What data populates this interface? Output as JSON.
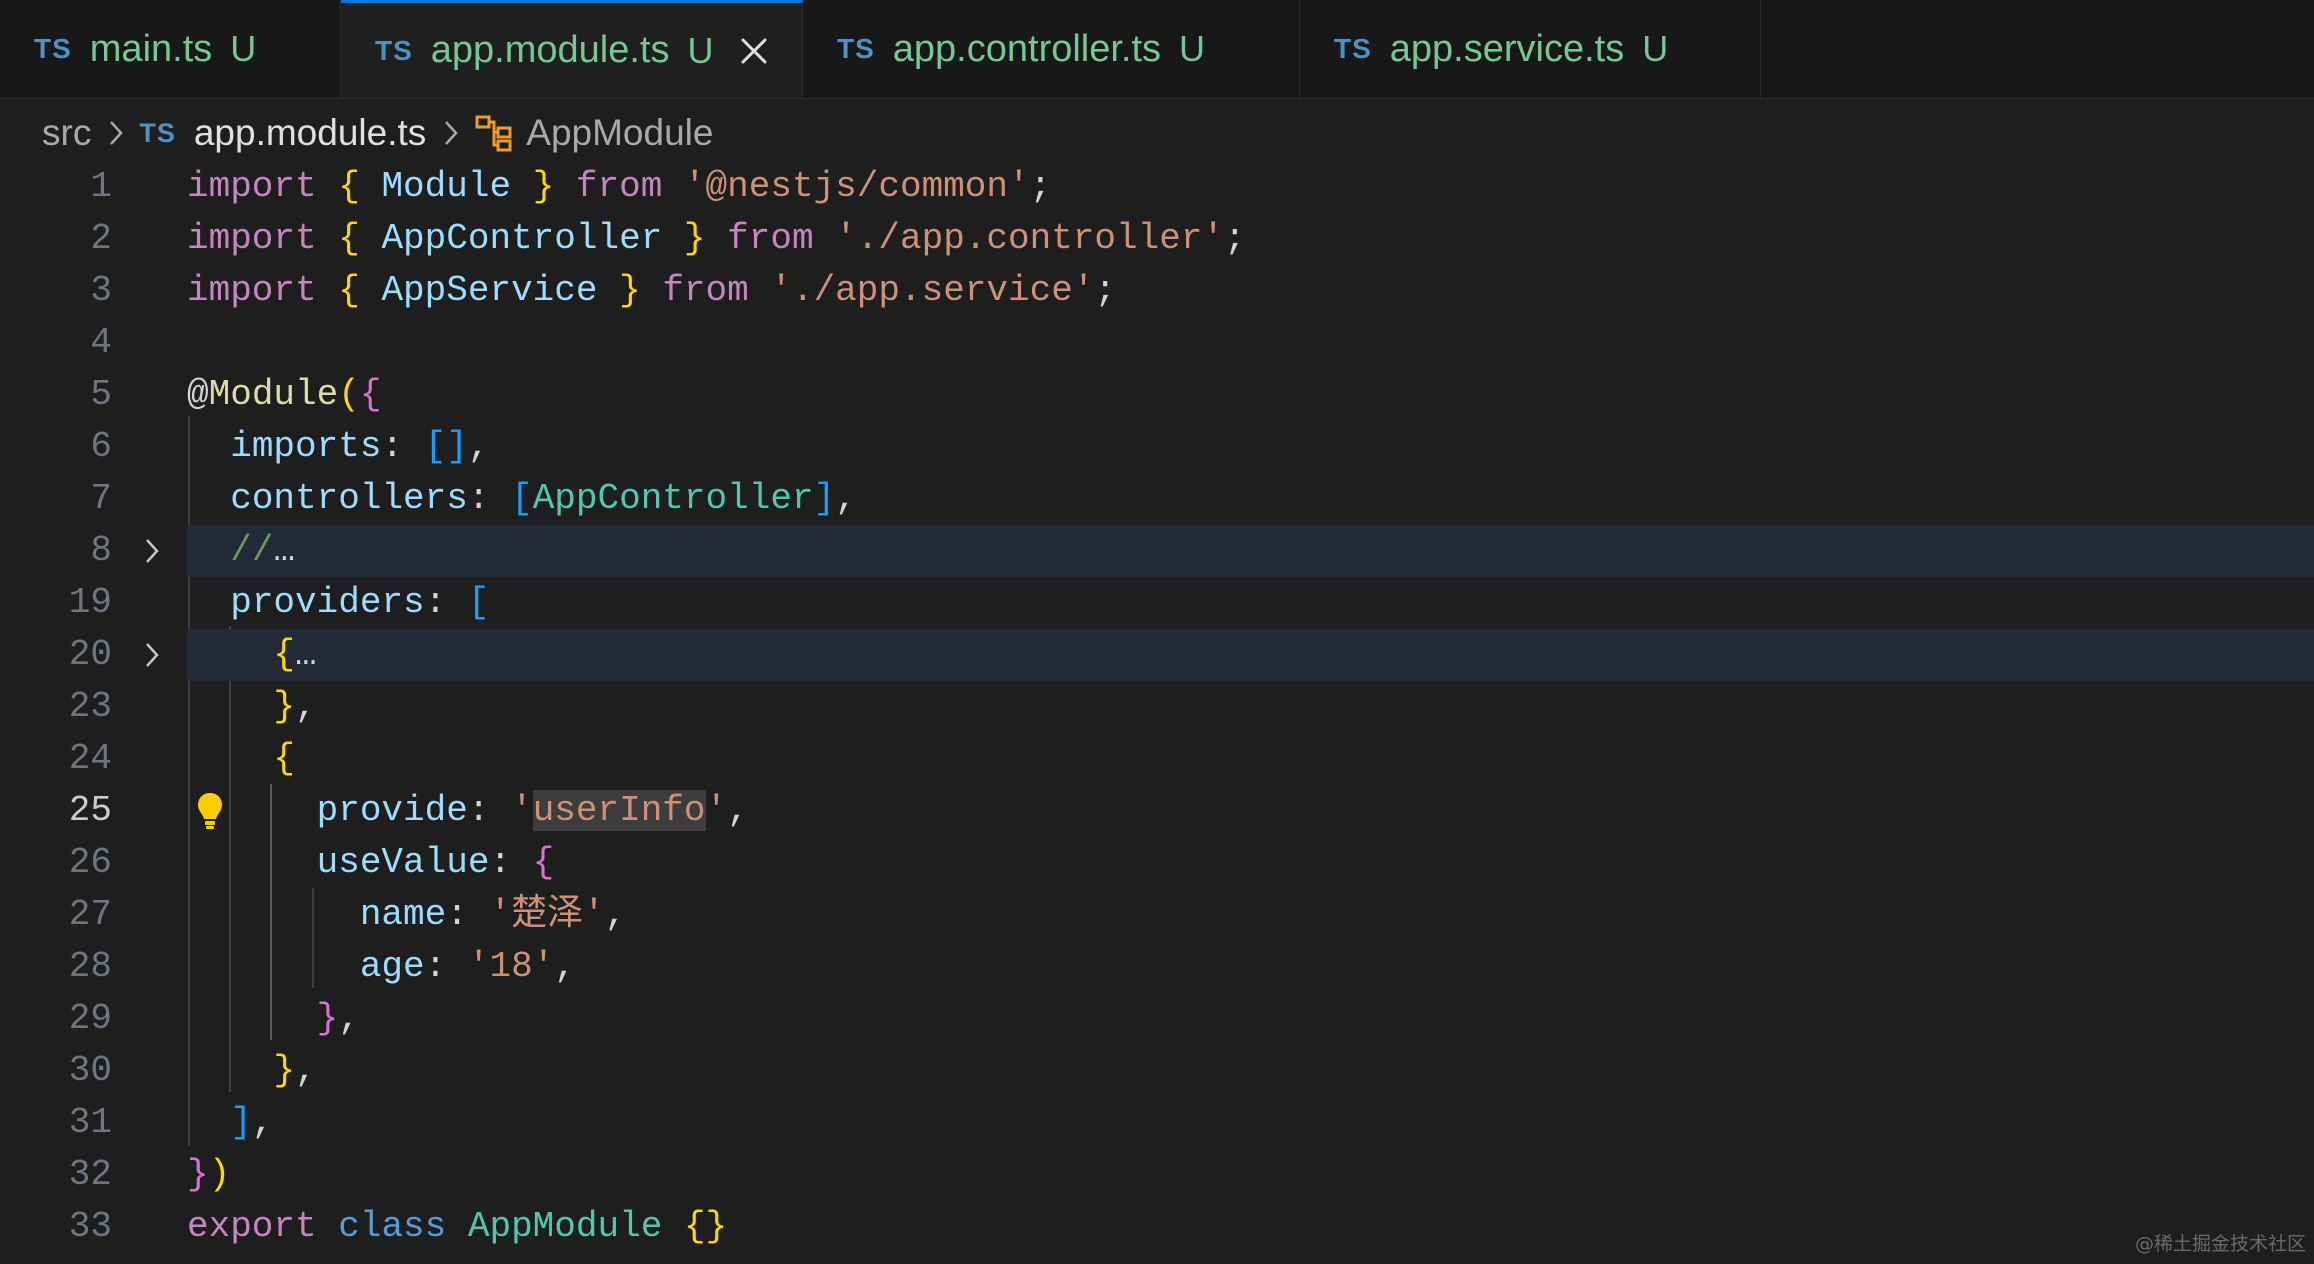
{
  "tabs": [
    {
      "lang": "TS",
      "name": "main.ts",
      "status": "U",
      "active": false
    },
    {
      "lang": "TS",
      "name": "app.module.ts",
      "status": "U",
      "active": true
    },
    {
      "lang": "TS",
      "name": "app.controller.ts",
      "status": "U",
      "active": false
    },
    {
      "lang": "TS",
      "name": "app.service.ts",
      "status": "U",
      "active": false
    }
  ],
  "breadcrumb": {
    "folder": "src",
    "lang": "TS",
    "file": "app.module.ts",
    "symbol": "AppModule"
  },
  "editor": {
    "current_line": "25",
    "lines": [
      {
        "n": "1",
        "tokens": [
          [
            "kw",
            "import"
          ],
          [
            "plain",
            " "
          ],
          [
            "b1",
            "{"
          ],
          [
            "plain",
            " "
          ],
          [
            "id",
            "Module"
          ],
          [
            "plain",
            " "
          ],
          [
            "b1",
            "}"
          ],
          [
            "plain",
            " "
          ],
          [
            "kw",
            "from"
          ],
          [
            "plain",
            " "
          ],
          [
            "str",
            "'@nestjs/common'"
          ],
          [
            "plain",
            ";"
          ]
        ]
      },
      {
        "n": "2",
        "tokens": [
          [
            "kw",
            "import"
          ],
          [
            "plain",
            " "
          ],
          [
            "b1",
            "{"
          ],
          [
            "plain",
            " "
          ],
          [
            "id",
            "AppController"
          ],
          [
            "plain",
            " "
          ],
          [
            "b1",
            "}"
          ],
          [
            "plain",
            " "
          ],
          [
            "kw",
            "from"
          ],
          [
            "plain",
            " "
          ],
          [
            "str",
            "'./app.controller'"
          ],
          [
            "plain",
            ";"
          ]
        ]
      },
      {
        "n": "3",
        "tokens": [
          [
            "kw",
            "import"
          ],
          [
            "plain",
            " "
          ],
          [
            "b1",
            "{"
          ],
          [
            "plain",
            " "
          ],
          [
            "id",
            "AppService"
          ],
          [
            "plain",
            " "
          ],
          [
            "b1",
            "}"
          ],
          [
            "plain",
            " "
          ],
          [
            "kw",
            "from"
          ],
          [
            "plain",
            " "
          ],
          [
            "str",
            "'./app.service'"
          ],
          [
            "plain",
            ";"
          ]
        ]
      },
      {
        "n": "4",
        "tokens": []
      },
      {
        "n": "5",
        "tokens": [
          [
            "plain",
            "@"
          ],
          [
            "dec",
            "Module"
          ],
          [
            "b1",
            "("
          ],
          [
            "b2",
            "{"
          ]
        ]
      },
      {
        "n": "6",
        "tokens": [
          [
            "plain",
            "  "
          ],
          [
            "id",
            "imports"
          ],
          [
            "plain",
            ": "
          ],
          [
            "b3",
            "[]"
          ],
          [
            "plain",
            ","
          ]
        ]
      },
      {
        "n": "7",
        "tokens": [
          [
            "plain",
            "  "
          ],
          [
            "id",
            "controllers"
          ],
          [
            "plain",
            ": "
          ],
          [
            "b3",
            "["
          ],
          [
            "cls",
            "AppController"
          ],
          [
            "b3",
            "]"
          ],
          [
            "plain",
            ","
          ]
        ]
      },
      {
        "n": "8",
        "tokens": [
          [
            "plain",
            "  "
          ],
          [
            "cm",
            "//"
          ],
          [
            "plain",
            "…"
          ]
        ],
        "fold": true,
        "hl": true
      },
      {
        "n": "19",
        "tokens": [
          [
            "plain",
            "  "
          ],
          [
            "id",
            "providers"
          ],
          [
            "plain",
            ": "
          ],
          [
            "b3",
            "["
          ]
        ]
      },
      {
        "n": "20",
        "tokens": [
          [
            "plain",
            "    "
          ],
          [
            "b1",
            "{"
          ],
          [
            "plain",
            "…"
          ]
        ],
        "fold": true,
        "hl": true
      },
      {
        "n": "23",
        "tokens": [
          [
            "plain",
            "    "
          ],
          [
            "b1",
            "}"
          ],
          [
            "plain",
            ","
          ]
        ]
      },
      {
        "n": "24",
        "tokens": [
          [
            "plain",
            "    "
          ],
          [
            "b1",
            "{"
          ]
        ]
      },
      {
        "n": "25",
        "tokens": [
          [
            "plain",
            "      "
          ],
          [
            "id",
            "provide"
          ],
          [
            "plain",
            ": "
          ],
          [
            "str",
            "'"
          ],
          [
            "strsel",
            "userInfo"
          ],
          [
            "str",
            "'"
          ],
          [
            "plain",
            ","
          ]
        ],
        "bulb": true
      },
      {
        "n": "26",
        "tokens": [
          [
            "plain",
            "      "
          ],
          [
            "id",
            "useValue"
          ],
          [
            "plain",
            ": "
          ],
          [
            "b2",
            "{"
          ]
        ]
      },
      {
        "n": "27",
        "tokens": [
          [
            "plain",
            "        "
          ],
          [
            "id",
            "name"
          ],
          [
            "plain",
            ": "
          ],
          [
            "str",
            "'楚泽'"
          ],
          [
            "plain",
            ","
          ]
        ]
      },
      {
        "n": "28",
        "tokens": [
          [
            "plain",
            "        "
          ],
          [
            "id",
            "age"
          ],
          [
            "plain",
            ": "
          ],
          [
            "str",
            "'18'"
          ],
          [
            "plain",
            ","
          ]
        ]
      },
      {
        "n": "29",
        "tokens": [
          [
            "plain",
            "      "
          ],
          [
            "b2",
            "}"
          ],
          [
            "plain",
            ","
          ]
        ]
      },
      {
        "n": "30",
        "tokens": [
          [
            "plain",
            "    "
          ],
          [
            "b1",
            "}"
          ],
          [
            "plain",
            ","
          ]
        ]
      },
      {
        "n": "31",
        "tokens": [
          [
            "plain",
            "  "
          ],
          [
            "b3",
            "]"
          ],
          [
            "plain",
            ","
          ]
        ]
      },
      {
        "n": "32",
        "tokens": [
          [
            "b2",
            "}"
          ],
          [
            "b1",
            ")"
          ]
        ]
      },
      {
        "n": "33",
        "tokens": [
          [
            "kw",
            "export"
          ],
          [
            "plain",
            " "
          ],
          [
            "kw2",
            "class"
          ],
          [
            "plain",
            " "
          ],
          [
            "cls",
            "AppModule"
          ],
          [
            "plain",
            " "
          ],
          [
            "b1",
            "{}"
          ]
        ]
      }
    ]
  },
  "watermark": "@稀土掘金技术社区",
  "colors": {
    "accent": "#0078d4",
    "untracked": "#73c991",
    "ts_badge": "#4e91c4",
    "lightbulb": "#ffcc00"
  }
}
